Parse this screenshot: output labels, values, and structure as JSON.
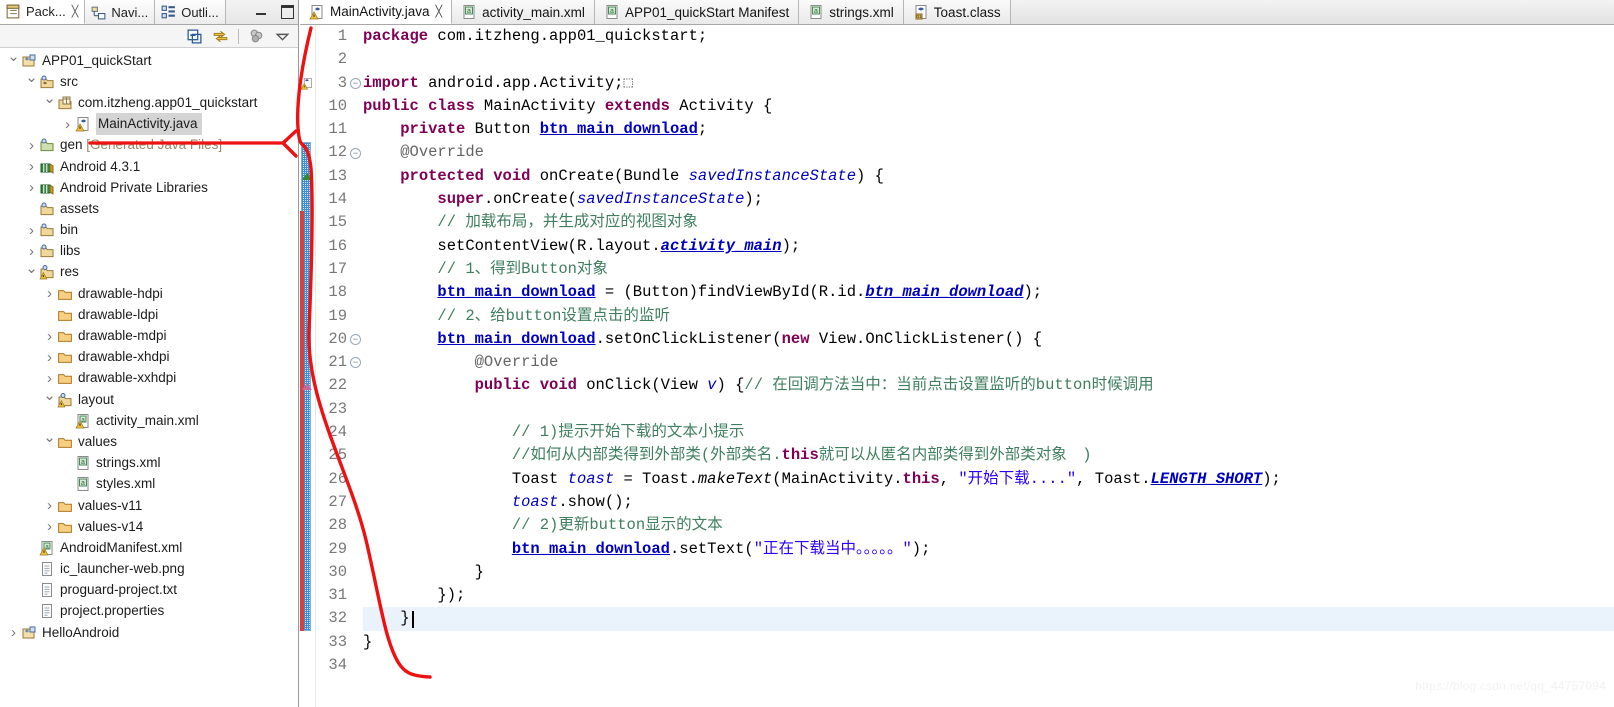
{
  "left_pane": {
    "view_tabs": [
      {
        "label": "Pack...",
        "icon": "package-explorer-icon",
        "active": true,
        "closable": true
      },
      {
        "label": "Navi...",
        "icon": "navigator-icon",
        "active": false,
        "closable": false
      },
      {
        "label": "Outli...",
        "icon": "outline-icon",
        "active": false,
        "closable": false
      }
    ],
    "window_buttons": [
      {
        "name": "minimize-button",
        "glyph": "minimize-icon"
      },
      {
        "name": "maximize-button",
        "glyph": "maximize-icon"
      }
    ],
    "toolbar": [
      {
        "name": "collapse-all-button",
        "icon": "collapse-all-icon"
      },
      {
        "name": "link-with-editor-button",
        "icon": "link-with-editor-icon"
      },
      {
        "name": "view-menu-focus-button",
        "icon": "focus-icon"
      },
      {
        "name": "view-menu-button",
        "icon": "chevron-down-icon"
      }
    ],
    "tree": [
      {
        "label": "APP01_quickStart",
        "depth": 0,
        "arrow": "open",
        "icon": "java-project-icon",
        "selected": false
      },
      {
        "label": "src",
        "depth": 1,
        "arrow": "open",
        "icon": "source-folder-icon",
        "selected": false
      },
      {
        "label": "com.itzheng.app01_quickstart",
        "depth": 2,
        "arrow": "open",
        "icon": "package-icon",
        "selected": false
      },
      {
        "label": "MainActivity.java",
        "depth": 3,
        "arrow": "closed",
        "icon": "java-file-warning-icon",
        "selected": true
      },
      {
        "label": "gen",
        "suffix": " [Generated Java Files]",
        "depth": 1,
        "arrow": "closed",
        "icon": "gen-source-folder-icon",
        "selected": false
      },
      {
        "label": "Android 4.3.1",
        "depth": 1,
        "arrow": "closed",
        "icon": "library-icon",
        "selected": false
      },
      {
        "label": "Android Private Libraries",
        "depth": 1,
        "arrow": "closed",
        "icon": "library-icon",
        "selected": false
      },
      {
        "label": "assets",
        "depth": 1,
        "arrow": "none",
        "icon": "folder-icon",
        "selected": false
      },
      {
        "label": "bin",
        "depth": 1,
        "arrow": "closed",
        "icon": "folder-icon",
        "selected": false
      },
      {
        "label": "libs",
        "depth": 1,
        "arrow": "closed",
        "icon": "folder-icon",
        "selected": false
      },
      {
        "label": "res",
        "depth": 1,
        "arrow": "open",
        "icon": "folder-warning-icon",
        "selected": false
      },
      {
        "label": "drawable-hdpi",
        "depth": 2,
        "arrow": "closed",
        "icon": "plain-folder-icon",
        "selected": false
      },
      {
        "label": "drawable-ldpi",
        "depth": 2,
        "arrow": "none",
        "icon": "plain-folder-icon",
        "selected": false
      },
      {
        "label": "drawable-mdpi",
        "depth": 2,
        "arrow": "closed",
        "icon": "plain-folder-icon",
        "selected": false
      },
      {
        "label": "drawable-xhdpi",
        "depth": 2,
        "arrow": "closed",
        "icon": "plain-folder-icon",
        "selected": false
      },
      {
        "label": "drawable-xxhdpi",
        "depth": 2,
        "arrow": "closed",
        "icon": "plain-folder-icon",
        "selected": false
      },
      {
        "label": "layout",
        "depth": 2,
        "arrow": "open",
        "icon": "folder-warning-icon",
        "selected": false
      },
      {
        "label": "activity_main.xml",
        "depth": 3,
        "arrow": "none",
        "icon": "xml-warning-icon",
        "selected": false
      },
      {
        "label": "values",
        "depth": 2,
        "arrow": "open",
        "icon": "plain-folder-icon",
        "selected": false
      },
      {
        "label": "strings.xml",
        "depth": 3,
        "arrow": "none",
        "icon": "xml-file-icon",
        "selected": false
      },
      {
        "label": "styles.xml",
        "depth": 3,
        "arrow": "none",
        "icon": "xml-file-icon",
        "selected": false
      },
      {
        "label": "values-v11",
        "depth": 2,
        "arrow": "closed",
        "icon": "plain-folder-icon",
        "selected": false
      },
      {
        "label": "values-v14",
        "depth": 2,
        "arrow": "closed",
        "icon": "plain-folder-icon",
        "selected": false
      },
      {
        "label": "AndroidManifest.xml",
        "depth": 1,
        "arrow": "none",
        "icon": "xml-warning-icon",
        "selected": false
      },
      {
        "label": "ic_launcher-web.png",
        "depth": 1,
        "arrow": "none",
        "icon": "file-icon",
        "selected": false
      },
      {
        "label": "proguard-project.txt",
        "depth": 1,
        "arrow": "none",
        "icon": "file-icon",
        "selected": false
      },
      {
        "label": "project.properties",
        "depth": 1,
        "arrow": "none",
        "icon": "file-icon",
        "selected": false
      },
      {
        "label": "HelloAndroid",
        "depth": 0,
        "arrow": "closed",
        "icon": "java-project-icon",
        "selected": false
      }
    ]
  },
  "editor": {
    "tabs": [
      {
        "label": "MainActivity.java",
        "icon": "java-file-warning-icon",
        "active": true,
        "closable": true
      },
      {
        "label": "activity_main.xml",
        "icon": "xml-file-icon",
        "active": false,
        "closable": false
      },
      {
        "label": "APP01_quickStart Manifest",
        "icon": "xml-file-icon",
        "active": false,
        "closable": false
      },
      {
        "label": "strings.xml",
        "icon": "xml-file-icon",
        "active": false,
        "closable": false
      },
      {
        "label": "Toast.class",
        "icon": "class-file-icon",
        "active": false,
        "closable": false
      }
    ],
    "gutter_numbers": [
      "1",
      "2",
      "3",
      "10",
      "11",
      "12",
      "13",
      "14",
      "15",
      "16",
      "17",
      "18",
      "19",
      "20",
      "21",
      "22",
      "23",
      "24",
      "25",
      "26",
      "27",
      "28",
      "29",
      "30",
      "31",
      "32",
      "33",
      "34"
    ],
    "current_line": "32",
    "fold_markers": [
      "3",
      "12",
      "20",
      "21"
    ],
    "code_lines": [
      {
        "n": "1",
        "tokens": [
          {
            "t": "package ",
            "c": "kw"
          },
          {
            "t": "com.itzheng.app01_quickstart;",
            "c": "plain"
          }
        ]
      },
      {
        "n": "2",
        "tokens": []
      },
      {
        "n": "3",
        "tokens": [
          {
            "t": "import ",
            "c": "kw"
          },
          {
            "t": "android.app.Activity;",
            "c": "plain"
          },
          {
            "t": "⬚",
            "c": "anno"
          }
        ]
      },
      {
        "n": "10",
        "tokens": [
          {
            "t": "public class ",
            "c": "kw"
          },
          {
            "t": "MainActivity ",
            "c": "plain"
          },
          {
            "t": "extends ",
            "c": "kw"
          },
          {
            "t": "Activity {",
            "c": "plain"
          }
        ]
      },
      {
        "n": "11",
        "tokens": [
          {
            "t": "    ",
            "c": "plain"
          },
          {
            "t": "private ",
            "c": "kw"
          },
          {
            "t": "Button ",
            "c": "plain"
          },
          {
            "t": "btn_main_download",
            "c": "fld"
          },
          {
            "t": ";",
            "c": "plain"
          }
        ]
      },
      {
        "n": "12",
        "tokens": [
          {
            "t": "    ",
            "c": "plain"
          },
          {
            "t": "@Override",
            "c": "anno"
          }
        ]
      },
      {
        "n": "13",
        "tokens": [
          {
            "t": "    ",
            "c": "plain"
          },
          {
            "t": "protected void ",
            "c": "kw"
          },
          {
            "t": "onCreate",
            "c": "plain"
          },
          {
            "t": "(Bundle ",
            "c": "plain"
          },
          {
            "t": "savedInstanceState",
            "c": "sfld"
          },
          {
            "t": ") {",
            "c": "plain"
          }
        ]
      },
      {
        "n": "14",
        "tokens": [
          {
            "t": "        ",
            "c": "plain"
          },
          {
            "t": "super",
            "c": "kw"
          },
          {
            "t": ".onCreate(",
            "c": "plain"
          },
          {
            "t": "savedInstanceState",
            "c": "sfld"
          },
          {
            "t": ");",
            "c": "plain"
          }
        ]
      },
      {
        "n": "15",
        "tokens": [
          {
            "t": "        ",
            "c": "plain"
          },
          {
            "t": "// 加载布局，并生成对应的视图对象",
            "c": "cmt"
          }
        ]
      },
      {
        "n": "16",
        "tokens": [
          {
            "t": "        ",
            "c": "plain"
          },
          {
            "t": "setContentView(R.layout.",
            "c": "plain"
          },
          {
            "t": "activity_main",
            "c": "stat"
          },
          {
            "t": ");",
            "c": "plain"
          }
        ]
      },
      {
        "n": "17",
        "tokens": [
          {
            "t": "        ",
            "c": "plain"
          },
          {
            "t": "// 1、得到Button对象",
            "c": "cmt"
          }
        ]
      },
      {
        "n": "18",
        "tokens": [
          {
            "t": "        ",
            "c": "plain"
          },
          {
            "t": "btn_main_download",
            "c": "fld"
          },
          {
            "t": " = (Button)findViewById(R.id.",
            "c": "plain"
          },
          {
            "t": "btn_main_download",
            "c": "stat"
          },
          {
            "t": ");",
            "c": "plain"
          }
        ]
      },
      {
        "n": "19",
        "tokens": [
          {
            "t": "        ",
            "c": "plain"
          },
          {
            "t": "// 2、给button设置点击的监听",
            "c": "cmt"
          }
        ]
      },
      {
        "n": "20",
        "tokens": [
          {
            "t": "        ",
            "c": "plain"
          },
          {
            "t": "btn_main_download",
            "c": "fld"
          },
          {
            "t": ".setOnClickListener(",
            "c": "plain"
          },
          {
            "t": "new ",
            "c": "kw"
          },
          {
            "t": "View.OnClickListener() {",
            "c": "plain"
          }
        ]
      },
      {
        "n": "21",
        "tokens": [
          {
            "t": "            ",
            "c": "plain"
          },
          {
            "t": "@Override",
            "c": "anno"
          }
        ]
      },
      {
        "n": "22",
        "tokens": [
          {
            "t": "            ",
            "c": "plain"
          },
          {
            "t": "public void ",
            "c": "kw"
          },
          {
            "t": "onClick(View ",
            "c": "plain"
          },
          {
            "t": "v",
            "c": "sfld"
          },
          {
            "t": ") {",
            "c": "plain"
          },
          {
            "t": "// 在回调方法当中：当前点击设置监听的button时候调用",
            "c": "cmt"
          }
        ]
      },
      {
        "n": "23",
        "tokens": []
      },
      {
        "n": "24",
        "tokens": [
          {
            "t": "                ",
            "c": "plain"
          },
          {
            "t": "// 1)提示开始下载的文本小提示",
            "c": "cmt"
          }
        ]
      },
      {
        "n": "25",
        "tokens": [
          {
            "t": "                ",
            "c": "plain"
          },
          {
            "t": "//如何从内部类得到外部类(外部类名.",
            "c": "cmt"
          },
          {
            "t": "this",
            "c": "kw"
          },
          {
            "t": "就可以从匿名内部类得到外部类对象　)",
            "c": "cmt"
          }
        ]
      },
      {
        "n": "26",
        "tokens": [
          {
            "t": "                ",
            "c": "plain"
          },
          {
            "t": "Toast ",
            "c": "plain"
          },
          {
            "t": "toast",
            "c": "sfld"
          },
          {
            "t": " = Toast.",
            "c": "plain"
          },
          {
            "t": "makeText",
            "c": "mth"
          },
          {
            "t": "(MainActivity.",
            "c": "plain"
          },
          {
            "t": "this",
            "c": "kw"
          },
          {
            "t": ", ",
            "c": "plain"
          },
          {
            "t": "\"开始下载....\"",
            "c": "str"
          },
          {
            "t": ", Toast.",
            "c": "plain"
          },
          {
            "t": "LENGTH_SHORT",
            "c": "stat"
          },
          {
            "t": ");",
            "c": "plain"
          }
        ]
      },
      {
        "n": "27",
        "tokens": [
          {
            "t": "                ",
            "c": "plain"
          },
          {
            "t": "toast",
            "c": "sfld"
          },
          {
            "t": ".show();",
            "c": "plain"
          }
        ]
      },
      {
        "n": "28",
        "tokens": [
          {
            "t": "                ",
            "c": "plain"
          },
          {
            "t": "// 2)更新button显示的文本",
            "c": "cmt"
          }
        ]
      },
      {
        "n": "29",
        "tokens": [
          {
            "t": "                ",
            "c": "plain"
          },
          {
            "t": "btn_main_download",
            "c": "fld"
          },
          {
            "t": ".setText(",
            "c": "plain"
          },
          {
            "t": "\"正在下载当中。。。。。\"",
            "c": "str"
          },
          {
            "t": ");",
            "c": "plain"
          }
        ]
      },
      {
        "n": "30",
        "tokens": [
          {
            "t": "            }",
            "c": "plain"
          }
        ]
      },
      {
        "n": "31",
        "tokens": [
          {
            "t": "        });",
            "c": "plain"
          }
        ]
      },
      {
        "n": "32",
        "tokens": [
          {
            "t": "    }",
            "c": "plain"
          }
        ]
      },
      {
        "n": "33",
        "tokens": [
          {
            "t": "}",
            "c": "plain"
          }
        ]
      },
      {
        "n": "34",
        "tokens": []
      }
    ]
  },
  "annotation": {
    "name": "red-handdrawn-arrow",
    "color": "#ee1111",
    "description": "red curved arrow pointing to MainActivity.java in the tree"
  },
  "watermark": {
    "text": "https://blog.csdn.net/qq_44757094"
  },
  "colors": {
    "keyword": "#7f0055",
    "comment": "#3f7f5f",
    "string": "#2a00ff",
    "field": "#0000c0",
    "annotation_red": "#ee1111",
    "selection_bg": "#d4d4d4",
    "current_line_bg": "#eaf2fb"
  }
}
